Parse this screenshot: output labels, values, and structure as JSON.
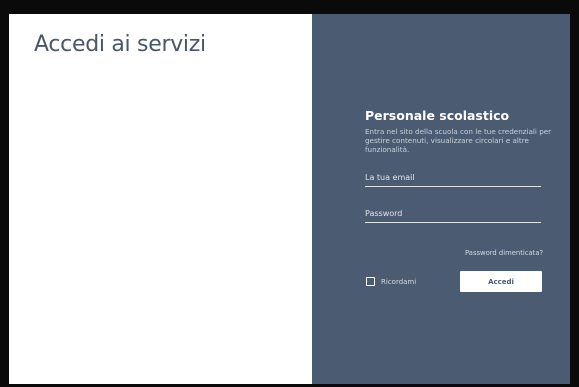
{
  "page": {
    "title": "Accedi ai servizi"
  },
  "login": {
    "title": "Personale scolastico",
    "description": "Entra nel sito della scuola con le tue credenziali per gestire contenuti, visualizzare circolari e altre funzionalità.",
    "email": {
      "placeholder": "La tua email",
      "value": ""
    },
    "password": {
      "placeholder": "Password",
      "value": ""
    },
    "forgot_password_label": "Password dimenticata?",
    "remember_label": "Ricordami",
    "remember_checked": false,
    "submit_label": "Accedi"
  },
  "colors": {
    "panel_background": "#4a5b72",
    "title_color": "#4a566a",
    "frame_border": "#0a0a0a"
  }
}
